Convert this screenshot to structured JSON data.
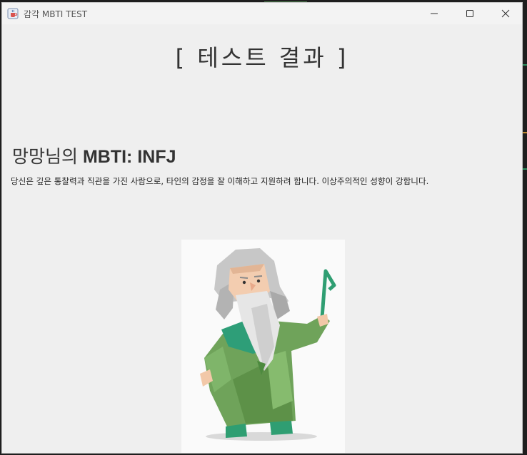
{
  "window": {
    "title": "감각 MBTI TEST"
  },
  "result": {
    "heading": "[ 테스트 결과 ]",
    "user_suffix": "망망님의 ",
    "mbti_label": "MBTI: INFJ",
    "description": "당신은 깊은 통찰력과 직관을 가진 사람으로, 타인의 감정을 잘 이해하고 지원하려 합니다. 이상주의적인 성향이 강합니다."
  },
  "colors": {
    "window_bg": "#efefef",
    "titlebar_bg": "#f3f3f3",
    "text": "#333333",
    "robe_green": "#6fa35a"
  },
  "icons": {
    "app": "java-cup-icon",
    "minimize": "minimize-icon",
    "maximize": "maximize-icon",
    "close": "close-icon"
  }
}
